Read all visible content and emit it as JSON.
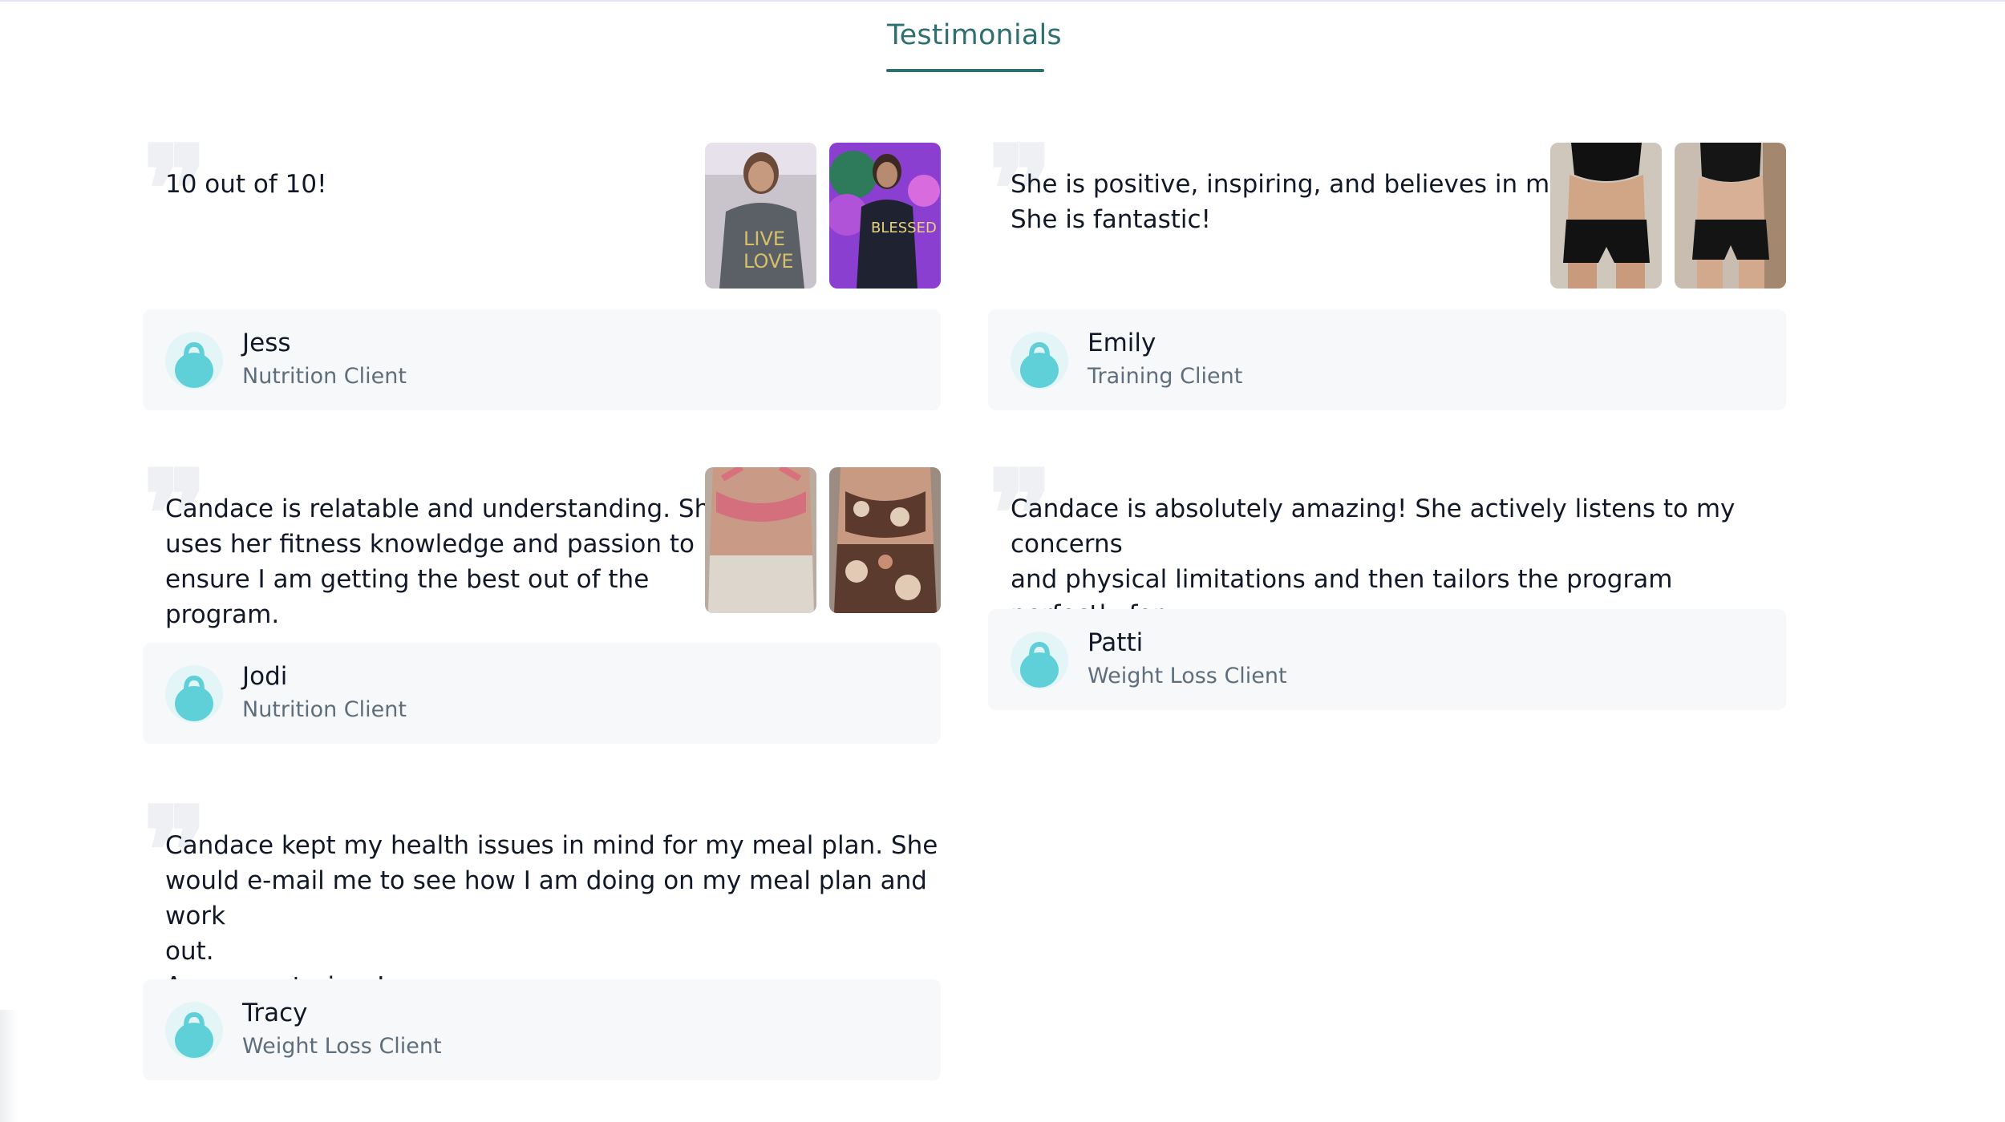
{
  "header": {
    "tab_label": "Testimonials"
  },
  "colors": {
    "accent": "#2f6f70",
    "card_background": "#f7f8fa",
    "avatar_fill": "#5fd0d8"
  },
  "testimonials": [
    {
      "quote": "10 out of 10!",
      "name": "Jess",
      "role": "Nutrition Client",
      "photos": [
        "before-photo",
        "after-photo"
      ]
    },
    {
      "quote": "She is positive, inspiring, and believes in me!\nShe is fantastic!",
      "name": "Emily",
      "role": "Training Client",
      "photos": [
        "before-photo",
        "after-photo"
      ]
    },
    {
      "quote": "Candace is relatable and understanding. She\nuses her fitness knowledge and passion to\nensure I am getting the best out of the\nprogram.",
      "name": "Jodi",
      "role": "Nutrition Client",
      "photos": [
        "before-photo",
        "after-photo"
      ]
    },
    {
      "quote": "Candace is absolutely amazing! She actively listens to my concerns\nand physical limitations and then tailors the program perfectly for\nme. She is positive, inspiring, and believes in me! She is fantastic!",
      "name": "Patti",
      "role": "Weight Loss Client",
      "photos": []
    },
    {
      "quote": "Candace kept my health issues in mind for my meal plan. She\nwould e-mail me to see how I am doing on my meal plan and work\nout.\nAwesome trainer!",
      "name": "Tracy",
      "role": "Weight Loss Client",
      "photos": []
    }
  ]
}
